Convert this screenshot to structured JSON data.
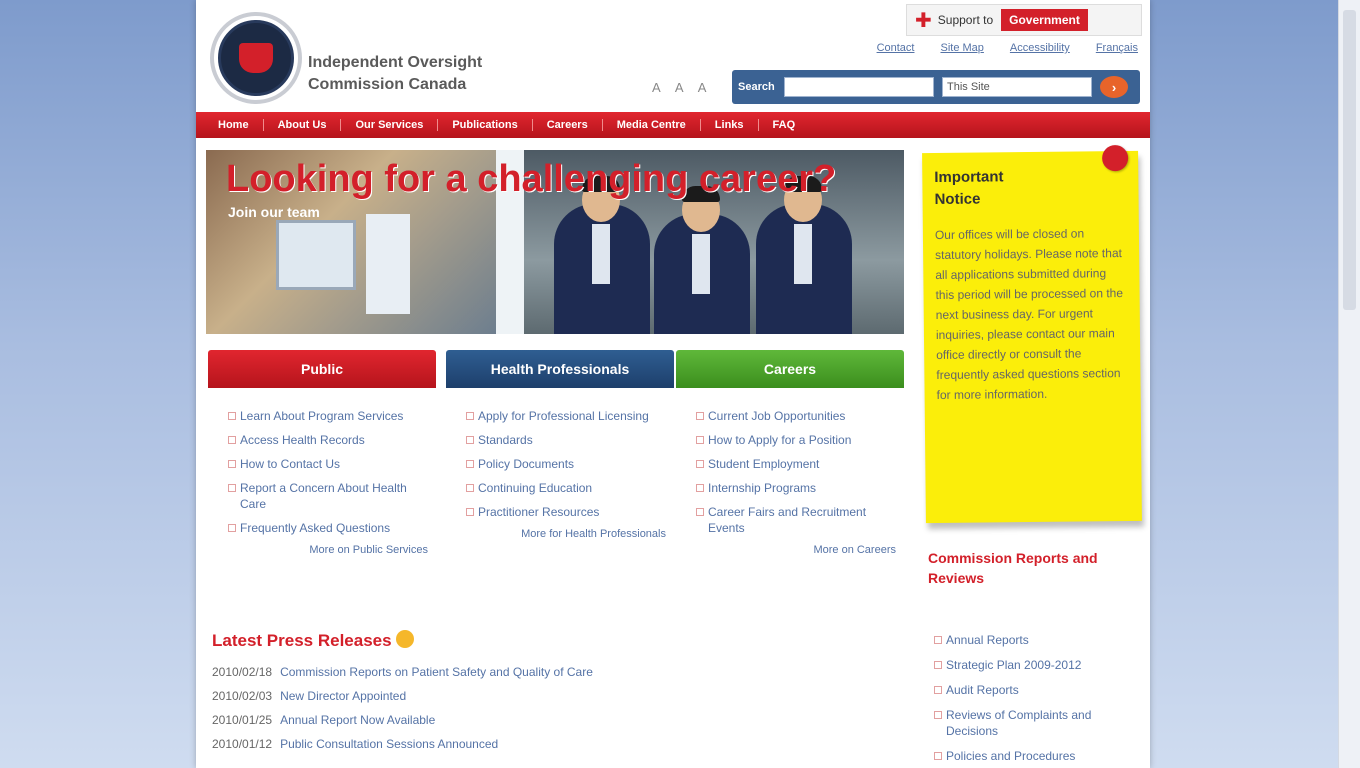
{
  "top_banner": {
    "text": "Support to",
    "highlight": "Government"
  },
  "utility_links": [
    "Contact",
    "Site Map",
    "Accessibility",
    "Français"
  ],
  "org_name_line1": "Independent Oversight",
  "org_name_line2": "Commission Canada",
  "text_size": "A A A",
  "search": {
    "label": "Search",
    "placeholder": "",
    "scope": "This Site"
  },
  "nav": [
    "Home",
    "About Us",
    "Our Services",
    "Publications",
    "Careers",
    "Media Centre",
    "Links",
    "FAQ"
  ],
  "hero": {
    "title": "Looking for a challenging career?",
    "subtitle": "Join our team"
  },
  "columns": [
    {
      "title": "Public",
      "items": [
        "Learn About Program Services",
        "Access Health Records",
        "How to Contact Us",
        "Report a Concern About Health Care",
        "Frequently Asked Questions"
      ],
      "more": "More on Public Services"
    },
    {
      "title": "Health Professionals",
      "items": [
        "Apply for Professional Licensing",
        "Standards",
        "Policy Documents",
        "Continuing Education",
        "Practitioner Resources"
      ],
      "more": "More for Health Professionals"
    },
    {
      "title": "Careers",
      "items": [
        "Current Job Opportunities",
        "How to Apply for a Position",
        "Student Employment",
        "Internship Programs",
        "Career Fairs and Recruitment Events"
      ],
      "more": "More on Careers"
    }
  ],
  "press": {
    "title": "Latest Press Releases",
    "items": [
      {
        "date": "2010/02/18",
        "text": "Commission Reports on Patient Safety and Quality of Care"
      },
      {
        "date": "2010/02/03",
        "text": "New Director Appointed"
      },
      {
        "date": "2010/01/25",
        "text": "Annual Report Now Available"
      },
      {
        "date": "2010/01/12",
        "text": "Public Consultation Sessions Announced"
      }
    ]
  },
  "note": {
    "title_line1": "Important",
    "title_line2": "Notice",
    "body": "Our offices will be closed on statutory holidays. Please note that all applications submitted during this period will be processed on the next business day. For urgent inquiries, please contact our main office directly or consult the frequently asked questions section for more information."
  },
  "side_box": {
    "title": "Commission Reports and Reviews",
    "items": [
      "Annual Reports",
      "Strategic Plan 2009-2012",
      "Audit Reports",
      "Reviews of Complaints and Decisions",
      "Policies and Procedures"
    ]
  }
}
